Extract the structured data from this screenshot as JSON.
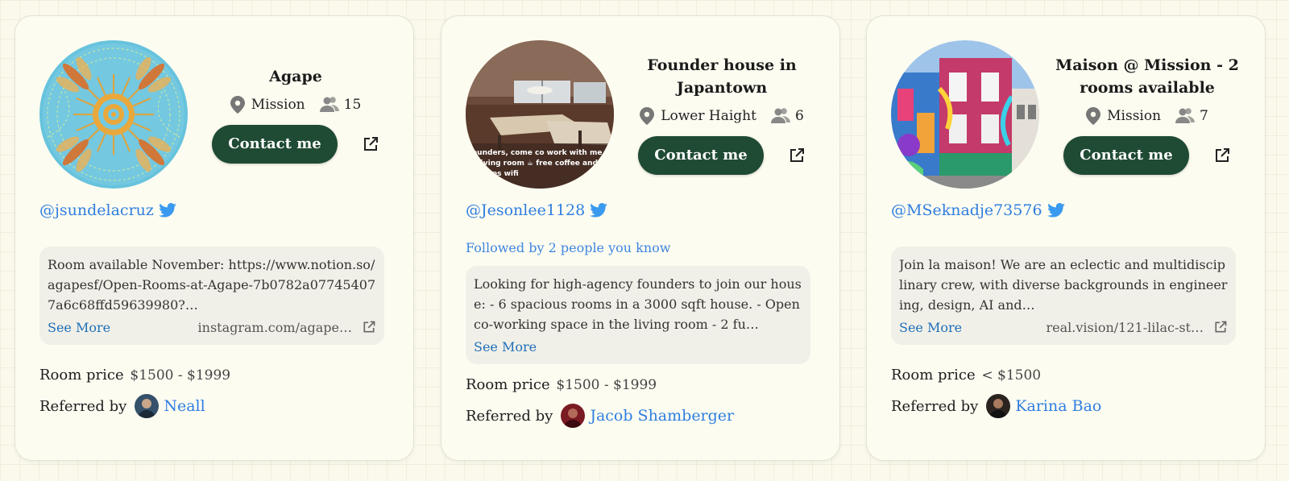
{
  "cards": [
    {
      "title": "Agape",
      "location": "Mission",
      "capacity": "15",
      "contact_label": "Contact me",
      "handle": "@jsundelacruz",
      "followed": "",
      "description": "Room available November: https://www.notion.so/agapesf/Open-Rooms-at-Agape-7b0782a077454077a6c68ffd59639980?…",
      "see_more": "See More",
      "link": "instagram.com/agape…",
      "price_label": "Room price",
      "price": "$1500 - $1999",
      "referred_label": "Referred by",
      "referrer": "Neall",
      "photo_icon": "dragonfly-sun-art",
      "avatar_icon": "person-avatar"
    },
    {
      "title": "Founder house in Japantown",
      "location": "Lower Haight",
      "capacity": "6",
      "contact_label": "Contact me",
      "handle": "@Jesonlee1128",
      "followed": "Followed by 2 people you know",
      "description": "Looking for high-agency founders to join our house: - 6 spacious rooms in a 3000 sqft house. - Open co-working space in the living room - 2 fu…",
      "see_more": "See More",
      "link": "",
      "price_label": "Room price",
      "price": "$1500 - $1999",
      "referred_label": "Referred by",
      "referrer": "Jacob Shamberger",
      "photo_text": [
        "ounders, come co work with me",
        "r living room ☕ free coffee and",
        "e Mbps wifi"
      ],
      "photo_icon": "coworking-room-photo",
      "avatar_icon": "person-avatar"
    },
    {
      "title": "Maison @ Mission - 2 rooms available",
      "location": "Mission",
      "capacity": "7",
      "contact_label": "Contact me",
      "handle": "@MSeknadje73576",
      "followed": "",
      "description": "Join la maison! We are an eclectic and multidisciplinary crew, with diverse backgrounds in engineering, design, AI and…",
      "see_more": "See More",
      "link": "real.vision/121-lilac-st…",
      "price_label": "Room price",
      "price": "< $1500",
      "referred_label": "Referred by",
      "referrer": "Karina Bao",
      "photo_icon": "mural-house-photo",
      "avatar_icon": "person-avatar"
    }
  ],
  "colors": {
    "accent_green": "#1f4a33",
    "link_blue": "#2f7ee0",
    "background": "#fbf9ec"
  }
}
